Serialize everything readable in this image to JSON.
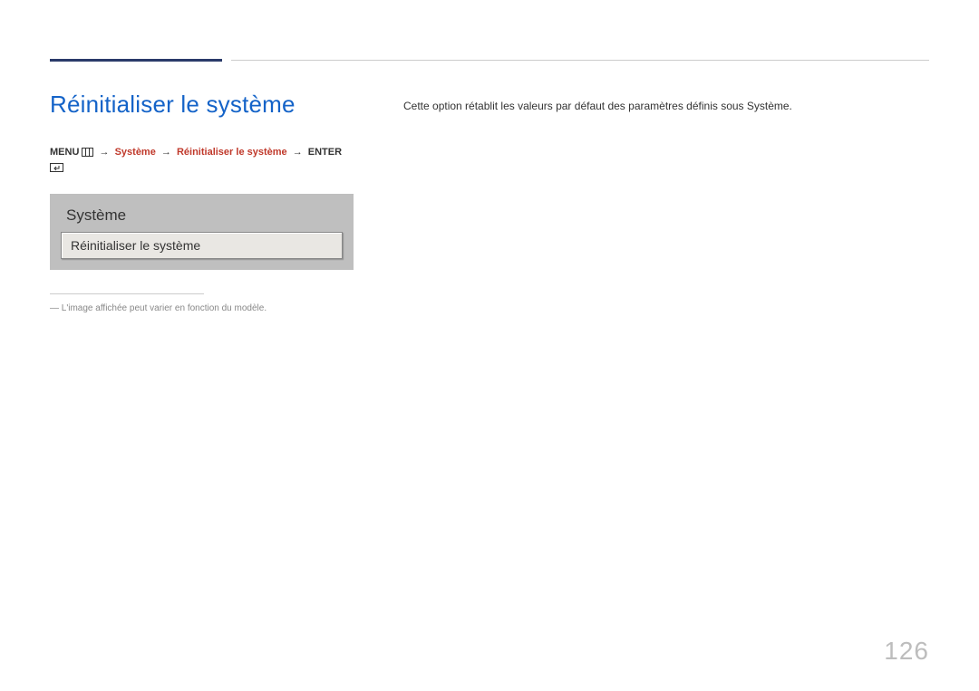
{
  "title": "Réinitialiser le système",
  "breadcrumb": {
    "menu": "MENU",
    "path1": "Système",
    "path2": "Réinitialiser le système",
    "enter": "ENTER"
  },
  "osd": {
    "header": "Système",
    "item": "Réinitialiser le système"
  },
  "footnote": "L'image affichée peut varier en fonction du modèle.",
  "description": "Cette option rétablit les valeurs par défaut des paramètres définis sous Système.",
  "page_number": "126"
}
